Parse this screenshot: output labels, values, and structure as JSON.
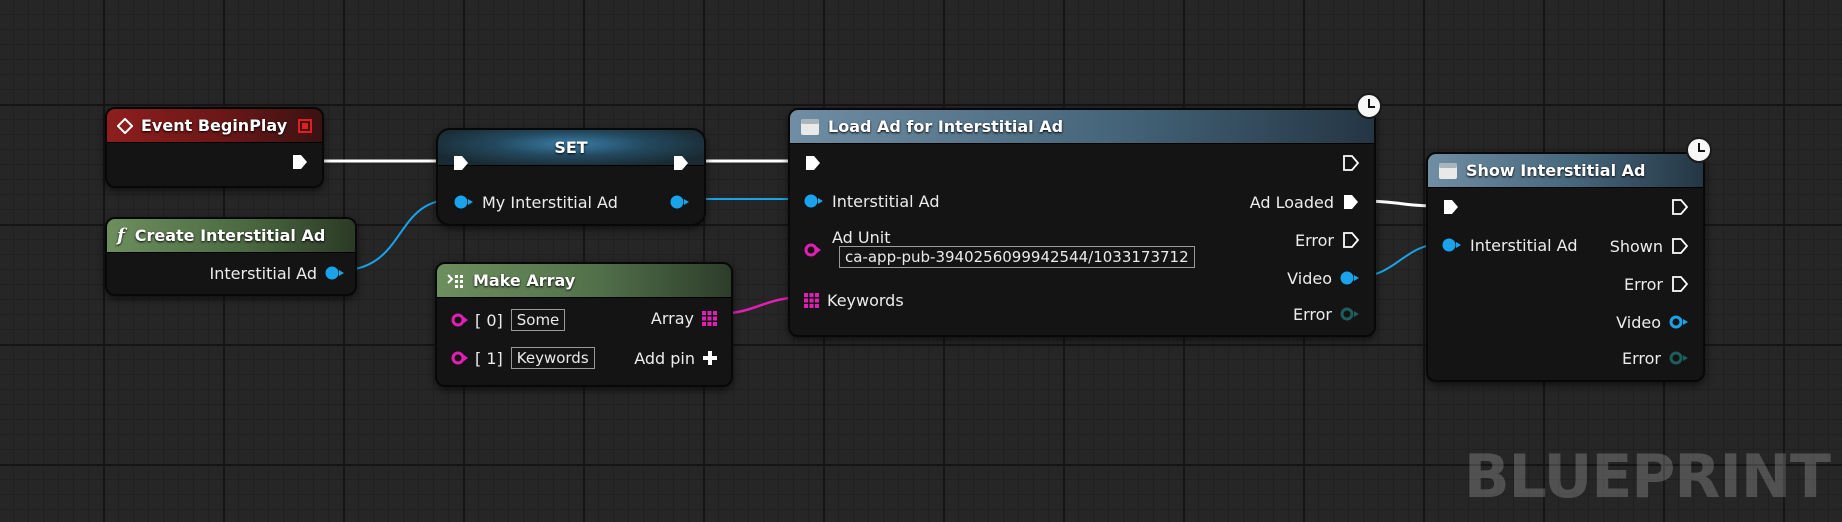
{
  "watermark": "BLUEPRINT",
  "nodes": {
    "event_begin_play": {
      "title": "Event BeginPlay"
    },
    "create_interstitial": {
      "title": "Create Interstitial Ad",
      "output_label": "Interstitial Ad"
    },
    "set": {
      "title": "SET",
      "input_label": "My Interstitial Ad"
    },
    "make_array": {
      "title": "Make Array",
      "inputs": [
        {
          "index_label": "[ 0]",
          "value": "Some"
        },
        {
          "index_label": "[ 1]",
          "value": "Keywords"
        }
      ],
      "output_label": "Array",
      "add_pin_label": "Add pin"
    },
    "load_ad": {
      "title": "Load Ad for Interstitial Ad",
      "input_labels": {
        "interstitial": "Interstitial Ad",
        "ad_unit": "Ad Unit",
        "keywords": "Keywords"
      },
      "ad_unit_value": "ca-app-pub-3940256099942544/1033173712",
      "output_labels": {
        "loaded": "Ad Loaded",
        "error": "Error",
        "video": "Video",
        "error_event": "Error"
      }
    },
    "show_ad": {
      "title": "Show Interstitial Ad",
      "input_label": "Interstitial Ad",
      "output_labels": {
        "shown": "Shown",
        "error": "Error",
        "video": "Video",
        "error_event": "Error"
      }
    }
  },
  "colors": {
    "exec_wire": "#ffffff",
    "object_wire": "#1aa3ea",
    "array_wire": "#e21fb4"
  }
}
